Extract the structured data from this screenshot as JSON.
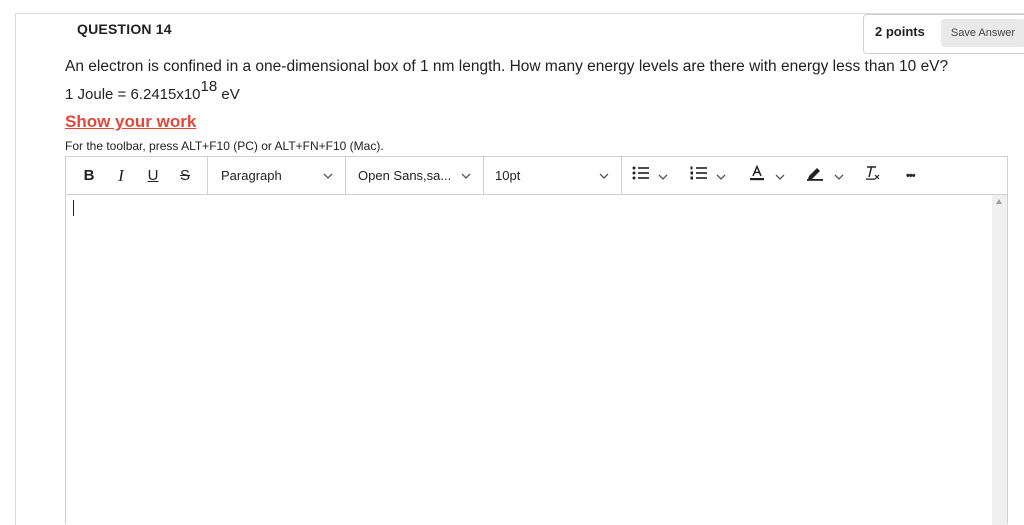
{
  "question": {
    "number_label": "QUESTION 14",
    "points": "2 points",
    "save_label": "Save Answer",
    "text": "An electron is confined in a one-dimensional box of 1 nm length. How many energy levels are there with energy less than 10 eV?",
    "conversion_prefix": "1 Joule = 6.2415x10",
    "conversion_exponent": "18",
    "conversion_suffix": " eV",
    "show_work": "Show your work"
  },
  "editor": {
    "toolbar_hint": "For the toolbar, press ALT+F10 (PC) or ALT+FN+F10 (Mac).",
    "format_buttons": {
      "bold": "B",
      "italic": "I",
      "underline": "U",
      "strikethrough": "S"
    },
    "block_format": "Paragraph",
    "font_family": "Open Sans,sa...",
    "font_size": "10pt",
    "more": "•••",
    "content": ""
  },
  "colors": {
    "accent_red": "#e0483c",
    "border": "#d0d0d0"
  },
  "icons": [
    "chevron-down-icon",
    "bulleted-list-icon",
    "numbered-list-icon",
    "text-color-icon",
    "highlight-icon",
    "clear-formatting-icon",
    "more-icon",
    "scroll-up-icon"
  ]
}
